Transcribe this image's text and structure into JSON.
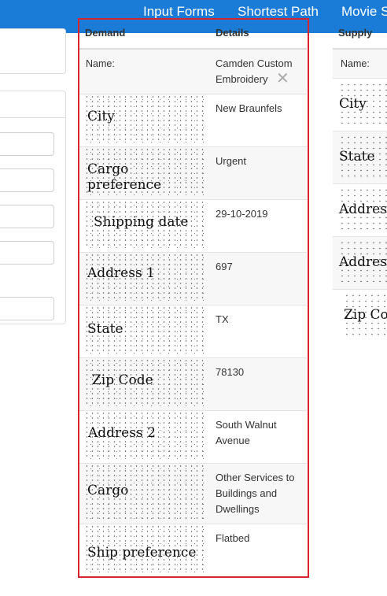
{
  "navbar": {
    "links": [
      "Input Forms",
      "Shortest Path",
      "Movie S"
    ]
  },
  "demand_table": {
    "headers": {
      "field": "Demand",
      "value": "Details"
    },
    "name_row": {
      "label": "Name:",
      "value": "Camden Custom Embroidery",
      "clear_icon": "close-icon"
    },
    "rows": [
      {
        "label": "City",
        "value": "New Braunfels"
      },
      {
        "label": "Cargo preference",
        "value": "Urgent"
      },
      {
        "label": "Shipping date",
        "value": "29-10-2019"
      },
      {
        "label": "Address 1",
        "value": "697"
      },
      {
        "label": "State",
        "value": "TX"
      },
      {
        "label": "Zip Code",
        "value": "78130"
      },
      {
        "label": "Address 2",
        "value": "South Walnut Avenue"
      },
      {
        "label": "Cargo",
        "value": "Other Services to Buildings and Dwellings"
      },
      {
        "label": "Ship preference",
        "value": "Flatbed"
      }
    ]
  },
  "supply_table": {
    "header": "Supply",
    "name_label": "Name:",
    "rows": [
      "City",
      "State",
      "Address",
      "Address",
      "Zip Code"
    ]
  }
}
